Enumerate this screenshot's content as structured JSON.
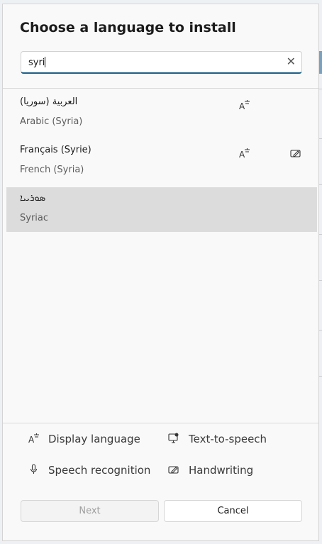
{
  "dialog": {
    "title": "Choose a language to install",
    "search": {
      "value": "syri",
      "clear_icon": "close-icon"
    },
    "languages": [
      {
        "native": "العربية (سوريا)",
        "english": "Arabic (Syria)",
        "features": [
          "display-language-icon"
        ],
        "selected": false
      },
      {
        "native": "Français (Syrie)",
        "english": "French (Syria)",
        "features": [
          "display-language-icon",
          "handwriting-icon"
        ],
        "selected": false
      },
      {
        "native": "ܣܘܪܝܝܐ",
        "english": "Syriac",
        "features": [],
        "selected": true
      }
    ],
    "legend": {
      "display_language": "Display language",
      "text_to_speech": "Text-to-speech",
      "speech_recognition": "Speech recognition",
      "handwriting": "Handwriting"
    },
    "buttons": {
      "next": "Next",
      "cancel": "Cancel"
    }
  }
}
